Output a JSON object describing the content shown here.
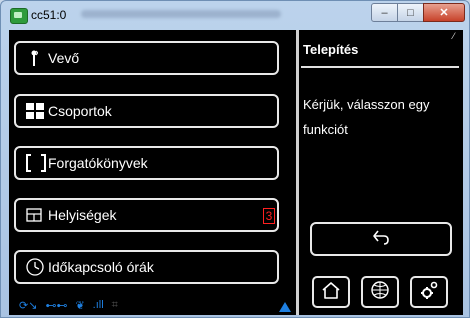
{
  "window": {
    "title": "cc51:0",
    "minimize": "–",
    "maximize": "□",
    "close": "✕"
  },
  "menu": [
    {
      "label": "Vevő",
      "icon": "receiver-icon"
    },
    {
      "label": "Csoportok",
      "icon": "groups-icon"
    },
    {
      "label": "Forgatókönyvek",
      "icon": "scenarios-icon"
    },
    {
      "label": "Helyiségek",
      "icon": "rooms-icon",
      "badge": "3"
    },
    {
      "label": "Időkapcsoló órák",
      "icon": "clock-icon"
    }
  ],
  "panel": {
    "title": "Telepítés",
    "message": "Kérjük, válasszon egy funkciót"
  },
  "colors": {
    "accent": "#1e7fe0",
    "badge": "#ff2020",
    "background": "#000000"
  }
}
